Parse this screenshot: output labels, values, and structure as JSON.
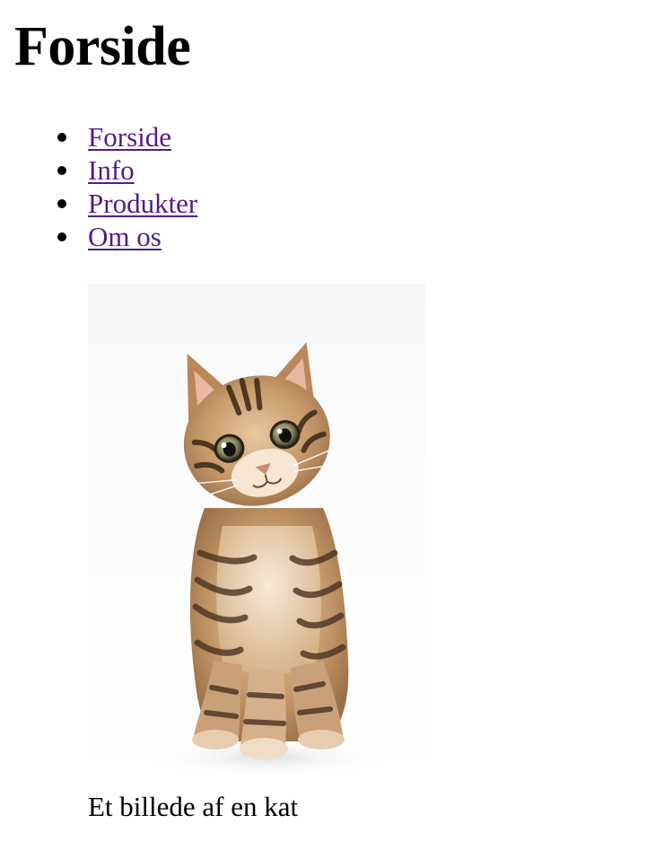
{
  "page": {
    "title": "Forside"
  },
  "nav": {
    "items": [
      {
        "label": "Forside"
      },
      {
        "label": "Info"
      },
      {
        "label": "Produkter"
      },
      {
        "label": "Om os"
      }
    ],
    "link_color": "#551a8b"
  },
  "figure": {
    "caption": "Et billede af en kat"
  }
}
